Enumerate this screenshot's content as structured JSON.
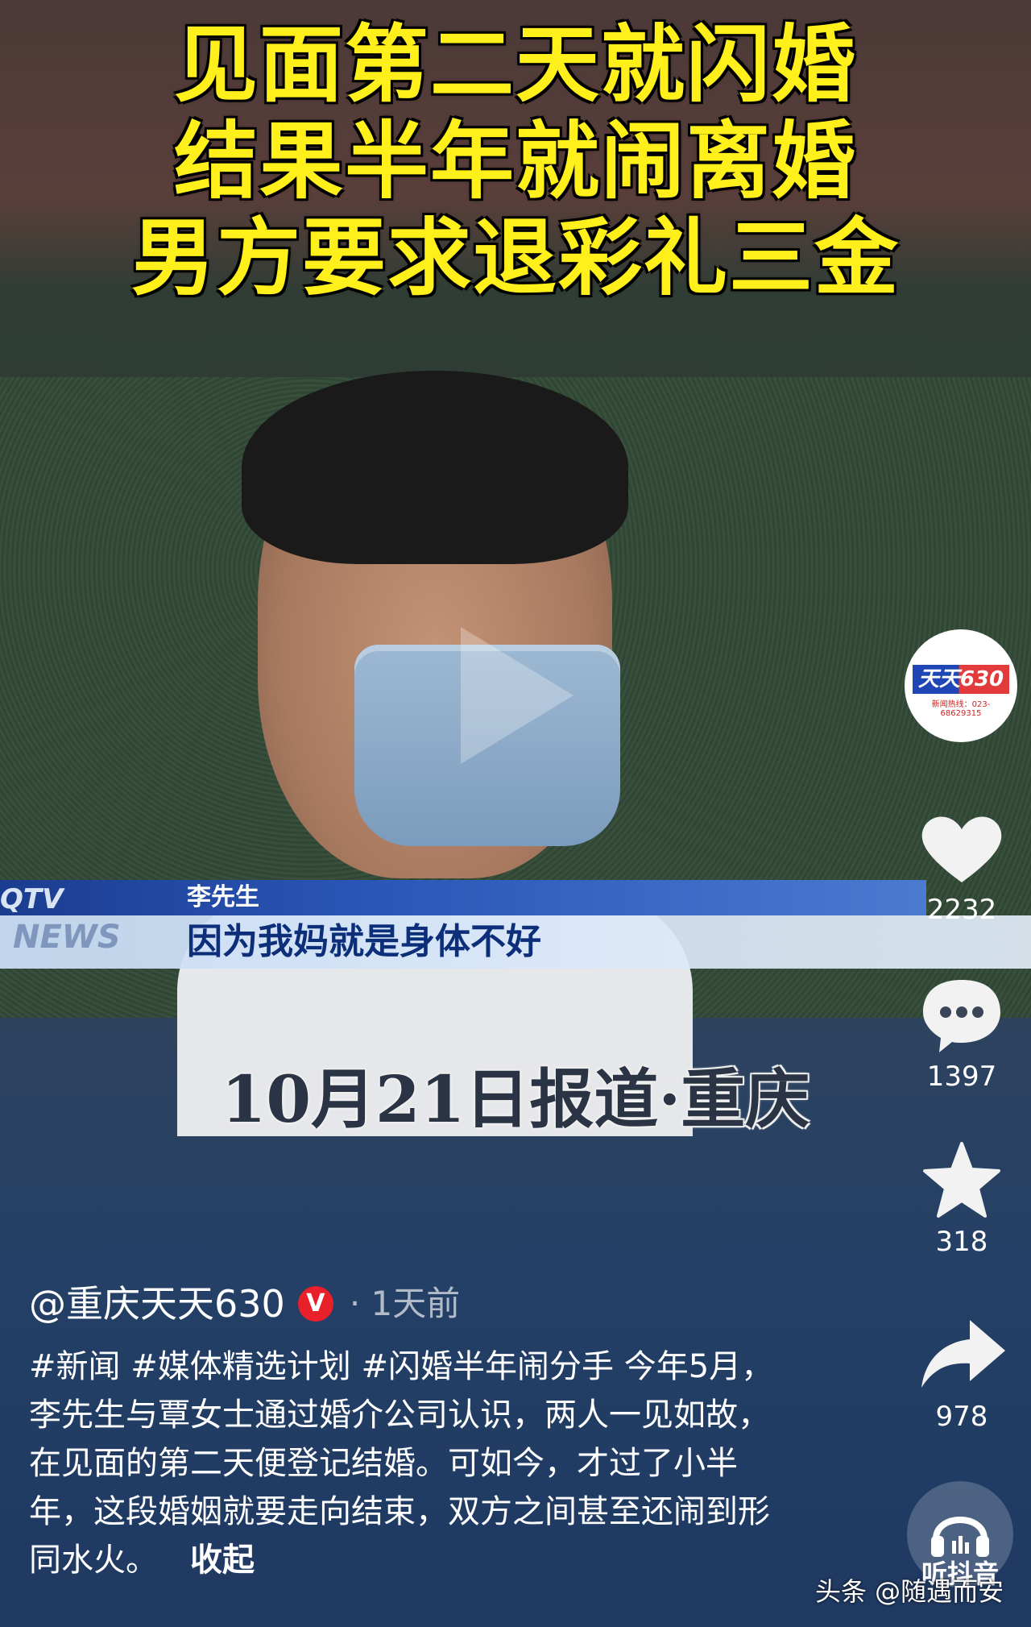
{
  "title_lines": [
    "见面第二天就闪婚",
    "结果半年就闹离婚",
    "男方要求退彩礼三金"
  ],
  "lower_third": {
    "brand_top": "QTV",
    "brand_bottom": "NEWS",
    "speaker": "李先生",
    "quote": "因为我妈就是身体不好"
  },
  "report_line": "10月21日报道·重庆",
  "avatar": {
    "logo_text": "天天630",
    "sub_text": "新闻热线：023-68629315"
  },
  "actions": {
    "like_count": "2232",
    "comment_count": "1397",
    "favorite_count": "318",
    "share_count": "978",
    "listen_label": "听抖音"
  },
  "post": {
    "author": "@重庆天天630",
    "verified_badge": "V",
    "time": "· 1天前",
    "description": "#新闻 #媒体精选计划 #闪婚半年闹分手 今年5月，李先生与覃女士通过婚介公司认识，两人一见如故，在见面的第二天便登记结婚。可如今，才过了小半年，这段婚姻就要走向结束，双方之间甚至还闹到形同水火。",
    "collapse_label": "收起"
  },
  "watermark": "头条 @随遇而安"
}
